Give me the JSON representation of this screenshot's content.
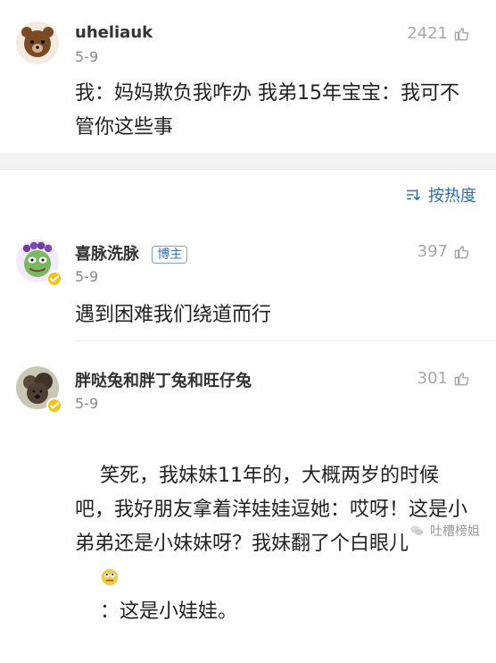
{
  "comments": [
    {
      "username": "uheliauk",
      "date": "5-9",
      "likes": "2421",
      "content": "我：妈妈欺负我咋办 我弟15年宝宝：我可不管你这些事",
      "avatar_icon": "bear-avatar-icon",
      "like_icon": "thumbs-up-icon"
    },
    {
      "username": "喜脉洗脉",
      "badge": "博主",
      "date": "5-9",
      "likes": "397",
      "content": "遇到困难我们绕道而行",
      "avatar_icon": "frog-avatar-icon",
      "like_icon": "thumbs-up-icon",
      "verified_icon": "verified-badge-icon"
    },
    {
      "username": "胖哒兔和胖丁兔和旺仔兔",
      "date": "5-9",
      "likes": "301",
      "content_prefix": "笑死，我妹妹11年的，大概两岁的时候吧，我好朋友拿着洋娃娃逗她：哎呀！这是小弟弟还是小妹妹呀？我妹翻了个白眼儿",
      "content_suffix": "：这是小娃娃。",
      "avatar_icon": "dog-avatar-icon",
      "like_icon": "thumbs-up-icon",
      "verified_icon": "verified-badge-icon",
      "emoji_icon": "eye-roll-emoji-icon"
    }
  ],
  "sort": {
    "label": "按热度",
    "icon": "sort-icon"
  },
  "watermark": {
    "label": "吐槽榜姐",
    "icon": "wechat-icon"
  },
  "colors": {
    "accent_blue": "#2f6fb0",
    "badge_yellow": "#f5c315",
    "like_gray": "#a8a8a8"
  }
}
